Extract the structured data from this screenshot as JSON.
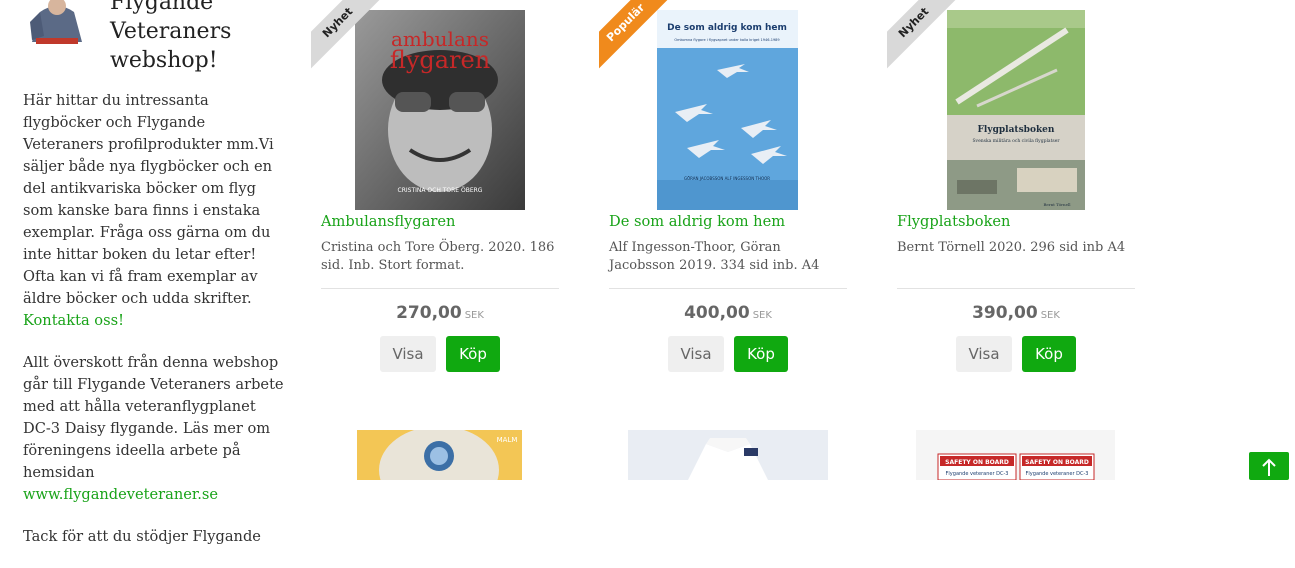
{
  "sidebar": {
    "title": "Flygande Veteraners webshop!",
    "intro_text": "Här hittar du intressanta flygböcker och Flygande Veteraners profilprodukter mm.Vi säljer både nya flygböcker och en del antikvariska böcker om flyg som kanske bara finns i enstaka exemplar. Fråga oss gärna om du inte hittar boken du letar efter! Ofta kan vi få fram exemplar av äldre böcker och udda skrifter.",
    "contact_link": "Kontakta oss!",
    "surplus_text": "Allt överskott från denna webshop går till Flygande Veteraners arbete med att hålla veteranflygplanet DC-3 Daisy flygande. Läs mer om föreningens ideella arbete på hemsidan",
    "website_link": "www.flygandeveteraner.se",
    "partial_text": "Tack för att du stödjer Flygande"
  },
  "colors": {
    "accent": "#10a910",
    "link": "#19a319",
    "ribbon_new": "#d9d9d9",
    "ribbon_popular": "#f08a1c"
  },
  "products": [
    {
      "ribbon": "Nyhet",
      "cover_title": "ambulans flygaren",
      "cover_author": "CRISTINA OCH TORE ÖBERG",
      "name": "Ambulansflygaren",
      "description": "Cristina och Tore Öberg. 2020. 186 sid. Inb. Stort format.",
      "price": "270,00",
      "currency": "SEK",
      "view_label": "Visa",
      "buy_label": "Köp"
    },
    {
      "ribbon": "Populär",
      "cover_title": "De som aldrig kom hem",
      "cover_subtitle": "Omkomna flygare i flygvapnet under kalla kriget 1946-1989",
      "cover_author": "GÖRAN JACOBSSON   ALF INGESSON THOOR",
      "name": "De som aldrig kom hem",
      "description": "Alf Ingesson-Thoor, Göran Jacobsson 2019. 334 sid inb. A4",
      "price": "400,00",
      "currency": "SEK",
      "view_label": "Visa",
      "buy_label": "Köp"
    },
    {
      "ribbon": "Nyhet",
      "cover_title": "Flygplatsboken",
      "cover_subtitle": "Svenska militära och civila flygplatser",
      "cover_author": "Bernt Törnell",
      "name": "Flygplatsboken",
      "description": "Bernt Törnell 2020. 296 sid inb A4",
      "price": "390,00",
      "currency": "SEK",
      "view_label": "Visa",
      "buy_label": "Köp"
    }
  ],
  "next_row": [
    {
      "label": "MALM"
    },
    {
      "label": ""
    },
    {
      "label": "SAFETY ON BOARD",
      "sub": "Flygande veteraner DC-3"
    }
  ]
}
